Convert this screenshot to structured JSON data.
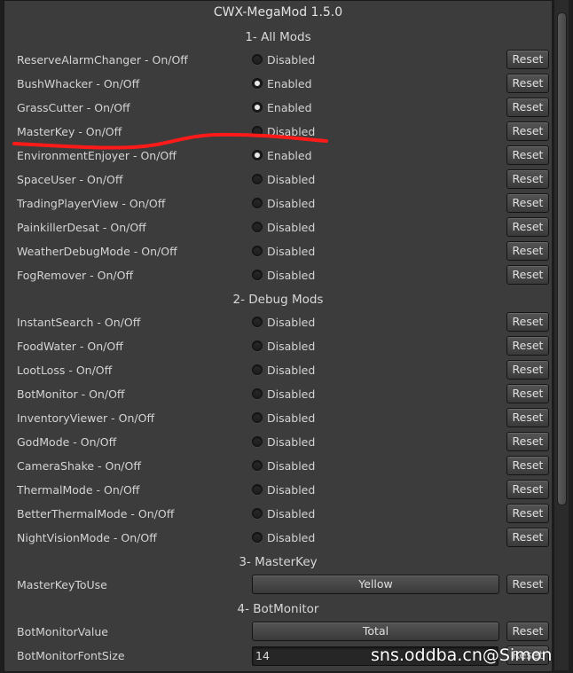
{
  "title": "CWX-MegaMod 1.5.0",
  "sections": [
    {
      "heading": "1- All Mods"
    },
    {
      "heading": "2- Debug Mods"
    },
    {
      "heading": "3- MasterKey"
    },
    {
      "heading": "4- BotMonitor"
    }
  ],
  "reset_label": "Reset",
  "all_mods": [
    {
      "label": "ReserveAlarmChanger - On/Off",
      "state": "Disabled",
      "enabled": false
    },
    {
      "label": "BushWhacker - On/Off",
      "state": "Enabled",
      "enabled": true
    },
    {
      "label": "GrassCutter - On/Off",
      "state": "Enabled",
      "enabled": true
    },
    {
      "label": "MasterKey - On/Off",
      "state": "Disabled",
      "enabled": false
    },
    {
      "label": "EnvironmentEnjoyer - On/Off",
      "state": "Enabled",
      "enabled": true
    },
    {
      "label": "SpaceUser - On/Off",
      "state": "Disabled",
      "enabled": false
    },
    {
      "label": "TradingPlayerView - On/Off",
      "state": "Disabled",
      "enabled": false
    },
    {
      "label": "PainkillerDesat - On/Off",
      "state": "Disabled",
      "enabled": false
    },
    {
      "label": "WeatherDebugMode - On/Off",
      "state": "Disabled",
      "enabled": false
    },
    {
      "label": "FogRemover - On/Off",
      "state": "Disabled",
      "enabled": false
    }
  ],
  "debug_mods": [
    {
      "label": "InstantSearch - On/Off",
      "state": "Disabled",
      "enabled": false
    },
    {
      "label": "FoodWater - On/Off",
      "state": "Disabled",
      "enabled": false
    },
    {
      "label": "LootLoss - On/Off",
      "state": "Disabled",
      "enabled": false
    },
    {
      "label": "BotMonitor - On/Off",
      "state": "Disabled",
      "enabled": false
    },
    {
      "label": "InventoryViewer - On/Off",
      "state": "Disabled",
      "enabled": false
    },
    {
      "label": "GodMode - On/Off",
      "state": "Disabled",
      "enabled": false
    },
    {
      "label": "CameraShake - On/Off",
      "state": "Disabled",
      "enabled": false
    },
    {
      "label": "ThermalMode - On/Off",
      "state": "Disabled",
      "enabled": false
    },
    {
      "label": "BetterThermalMode - On/Off",
      "state": "Disabled",
      "enabled": false
    },
    {
      "label": "NightVisionMode - On/Off",
      "state": "Disabled",
      "enabled": false
    }
  ],
  "masterkey": {
    "label": "MasterKeyToUse",
    "value": "Yellow"
  },
  "botmonitor": {
    "value_label": "BotMonitorValue",
    "value": "Total",
    "font_label": "BotMonitorFontSize",
    "font_size": "14"
  },
  "annotation_color": "#ff1a1a",
  "watermark": "sns.oddba.cn@Simon"
}
